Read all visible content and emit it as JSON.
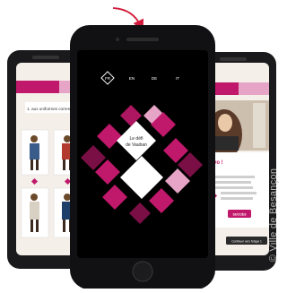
{
  "center_phone": {
    "lang_options": [
      "FR",
      "EN",
      "DE",
      "IT"
    ],
    "title_line1": "Le défi",
    "title_line2": "de Vauban"
  },
  "left_phone": {
    "question": "1. aux uniformes corresp…"
  },
  "right_phone": {
    "bravo": "Bravo !",
    "button": "SUCCÈS",
    "footer_button": "Continuer vers l'étape 1"
  },
  "credit": "© Ville de Besançon",
  "colors": {
    "magenta": "#c0186a",
    "dark_magenta": "#7a0f45",
    "pink": "#e6a5c6",
    "phone_black": "#1a1a1c",
    "arrow": "#d21a3a"
  }
}
